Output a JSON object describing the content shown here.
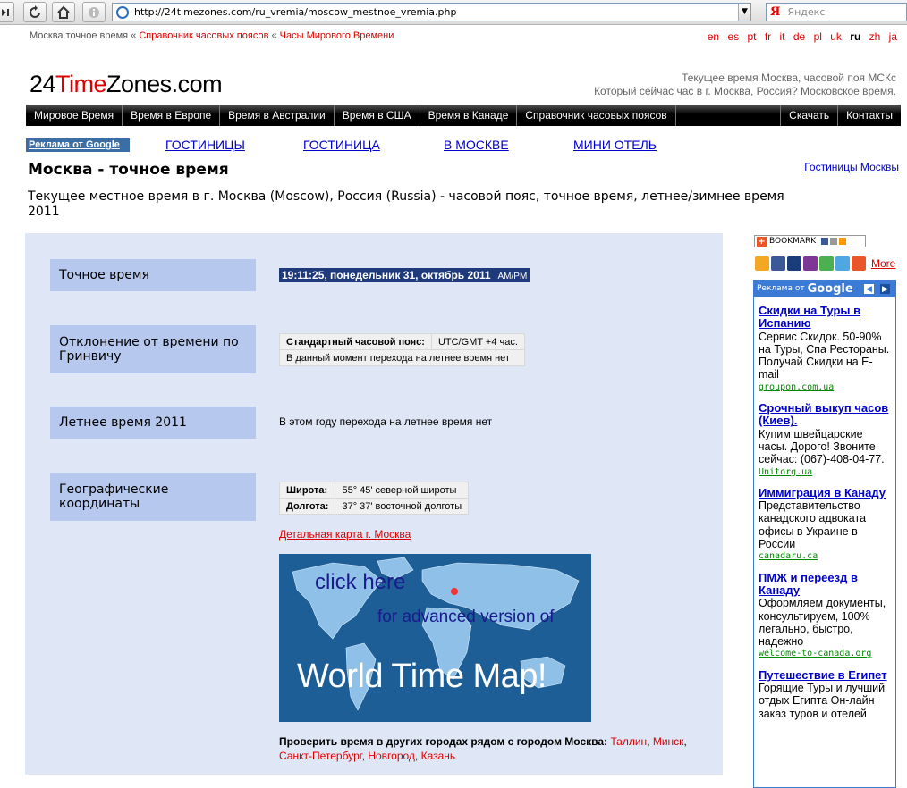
{
  "browser": {
    "url": "http://24timezones.com/ru_vremia/moscow_mestnoe_vremia.php",
    "search_logo": "Я",
    "search_placeholder": "Яндекс"
  },
  "crumbs": {
    "current": "Москва точное время",
    "sep1": "«",
    "link1": "Справочник часовых поясов",
    "sep2": "«",
    "link2": "Часы Мирового Времени"
  },
  "langs": [
    "en",
    "es",
    "pt",
    "fr",
    "it",
    "de",
    "pl",
    "uk",
    "ru",
    "zh",
    "ja"
  ],
  "lang_current": "ru",
  "logo": {
    "part1": "24",
    "part2": "Time",
    "part3": "Zones",
    "part4": ".com"
  },
  "tagline": {
    "line1": "Текущее время Москва, часовой поя МСКс",
    "line2": "Который сейчас час в г. Москва, Россия? Московское время."
  },
  "nav": {
    "items": [
      "Мировое Время",
      "Время в Европе",
      "Время в Австралии",
      "Время в США",
      "Время в Канаде",
      "Справочник часовых поясов"
    ],
    "right": [
      "Скачать",
      "Контакты"
    ]
  },
  "ads_row": {
    "label": "Реклама от Google",
    "links": [
      "ГОСТИНИЦЫ",
      "ГОСТИНИЦА",
      "В МОСКВЕ",
      "МИНИ ОТЕЛЬ"
    ]
  },
  "hotels_link": "Гостиницы Москвы",
  "title": "Москва - точное время",
  "description": "Текущее местное время в г. Москва (Moscow), Россия (Russia) - часовой пояс, точное время, летнее/зимнее время 2011",
  "rows": {
    "time_label": "Точное время",
    "time_value": "19:11:25, понедельник 31, октябрь 2011",
    "ampm": "AM/PM",
    "gmt_label": "Отклонение от времени по Гринвичу",
    "tz_key": "Стандартный часовой пояс:",
    "tz_val": "UTC/GMT +4 час.",
    "dst_note": "В данный момент перехода на летнее время нет",
    "summer_label": "Летнее время 2011",
    "summer_value": "В этом году перехода на летнее время нет",
    "geo_label": "Географические координаты",
    "lat_key": "Широта:",
    "lat_val": "55° 45' северной широты",
    "lon_key": "Долгота:",
    "lon_val": "37° 37' восточной долготы",
    "map_link": "Детальная карта г. Москва"
  },
  "map_banner": {
    "line1": "click here",
    "line2": "for advanced version of",
    "line3": "World Time Map!"
  },
  "near": {
    "prefix": "Проверить время в других городах рядом с городом Москва:",
    "cities": [
      "Таллин",
      "Минск",
      "Санкт-Петербург",
      "Новгород",
      "Казань"
    ]
  },
  "bookmark": {
    "label": "BOOKMARK"
  },
  "social": {
    "more": "More"
  },
  "google_ads": {
    "header": "Реклама от",
    "brand": "Google",
    "items": [
      {
        "title": "Скидки на Туры в Испанию",
        "desc": "Сервис Скидок. 50-90% на Туры, Спа Рестораны. Получай Скидки на E-mail",
        "url": "groupon.com.ua"
      },
      {
        "title": "Срочный выкуп часов (Киев).",
        "desc": "Купим швейцарские часы. Дорого! Звоните сейчас: (067)-408-04-77.",
        "url": "Unitorg.ua"
      },
      {
        "title": "Иммиграция в Канаду",
        "desc": "Представительство канадского адвоката офисы в Украине в России",
        "url": "canadaru.ca"
      },
      {
        "title": "ПМЖ и переезд в Канаду",
        "desc": "Оформляем документы, консультируем, 100% легально, быстро, надежно",
        "url": "welcome-to-canada.org"
      },
      {
        "title": "Путешествие в Египет",
        "desc": "Горящие Туры и лучший отдых Египта Он-лайн заказ туров и отелей",
        "url": ""
      }
    ]
  },
  "colors": {
    "accent_red": "#dd0000",
    "nav_bg": "#000000",
    "panel_bg": "#dfe7f7",
    "label_bg": "#b7c8ee",
    "link_blue": "#0000cc"
  }
}
